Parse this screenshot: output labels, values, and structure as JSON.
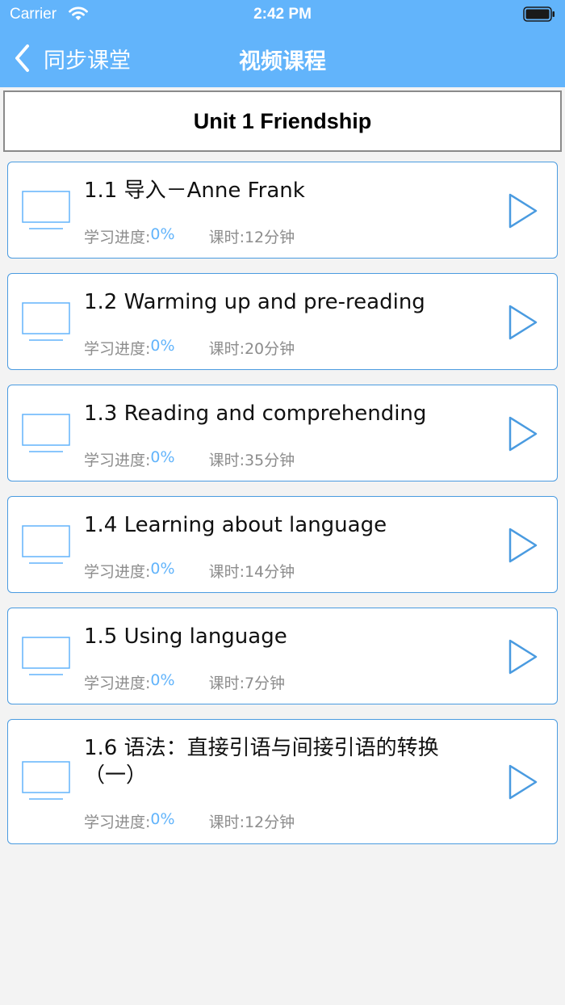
{
  "status_bar": {
    "carrier": "Carrier",
    "time": "2:42 PM"
  },
  "nav": {
    "back_label": "同步课堂",
    "title": "视频课程"
  },
  "unit": {
    "title": "Unit 1 Friendship"
  },
  "labels": {
    "progress_prefix": "学习进度:",
    "duration_prefix": "课时:"
  },
  "colors": {
    "accent": "#62b4fb",
    "card_border": "#4a9be0",
    "background": "#f3f3f3"
  },
  "icons": {
    "thumb": "monitor-icon",
    "play": "play-icon",
    "back": "chevron-left-icon"
  },
  "lessons": [
    {
      "title": "1.1 导入－Anne Frank",
      "progress": "0%",
      "duration": "12分钟"
    },
    {
      "title": "1.2 Warming up and pre-reading",
      "progress": "0%",
      "duration": "20分钟"
    },
    {
      "title": "1.3 Reading and comprehending",
      "progress": "0%",
      "duration": "35分钟"
    },
    {
      "title": "1.4 Learning about language",
      "progress": "0%",
      "duration": "14分钟"
    },
    {
      "title": "1.5 Using language",
      "progress": "0%",
      "duration": "7分钟"
    },
    {
      "title": "1.6 语法：直接引语与间接引语的转换（一）",
      "progress": "0%",
      "duration": "12分钟"
    }
  ]
}
